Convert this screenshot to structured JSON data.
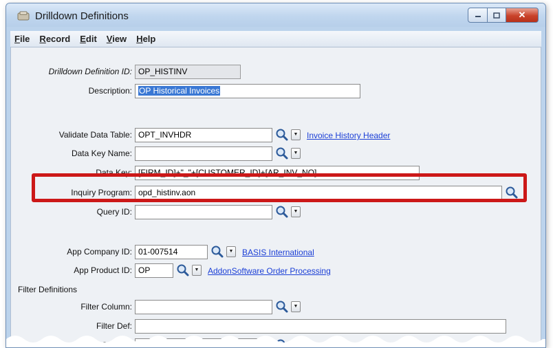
{
  "window": {
    "title": "Drilldown Definitions",
    "close_glyph": "✕"
  },
  "menu": [
    {
      "ul": "F",
      "rest": "ile"
    },
    {
      "ul": "R",
      "rest": "ecord"
    },
    {
      "ul": "E",
      "rest": "dit"
    },
    {
      "ul": "V",
      "rest": "iew"
    },
    {
      "ul": "H",
      "rest": "elp"
    }
  ],
  "form": {
    "drilldown_id": {
      "label": "Drilldown Definition ID:",
      "value": "OP_HISTINV"
    },
    "description": {
      "label": "Description:",
      "value": "OP Historical Invoices"
    },
    "validate_table": {
      "label": "Validate Data Table:",
      "value": "OPT_INVHDR",
      "link": "Invoice History Header"
    },
    "data_key_name": {
      "label": "Data Key Name:",
      "value": ""
    },
    "data_key": {
      "label": "Data Key:",
      "value": "[FIRM_ID]+\"_\"+[CUSTOMER_ID]+[AR_INV_NO]"
    },
    "inquiry_program": {
      "label": "Inquiry Program:",
      "value": "opd_histinv.aon"
    },
    "query_id": {
      "label": "Query ID:",
      "value": ""
    },
    "app_company_id": {
      "label": "App Company ID:",
      "value": "01-007514",
      "link": "BASIS International"
    },
    "app_product_id": {
      "label": "App Product ID:",
      "value": "OP",
      "link": "AddonSoftware Order Processing"
    }
  },
  "filters": {
    "section_label": "Filter Definitions",
    "filter_column": {
      "label": "Filter Column:",
      "value": ""
    },
    "filter_def": {
      "label": "Filter Def:",
      "value": ""
    },
    "filter_column_2": {
      "label": "Filter Column:",
      "value": ""
    }
  },
  "icons": {
    "lookup": "magnifier-icon",
    "dropdown": "dropdown-arrow-icon",
    "app": "drilldown-app-icon"
  },
  "colors": {
    "highlight": "#cc1818",
    "link": "#1a3ed6",
    "selection": "#3a78d4"
  },
  "dropdown_glyph": "▼"
}
